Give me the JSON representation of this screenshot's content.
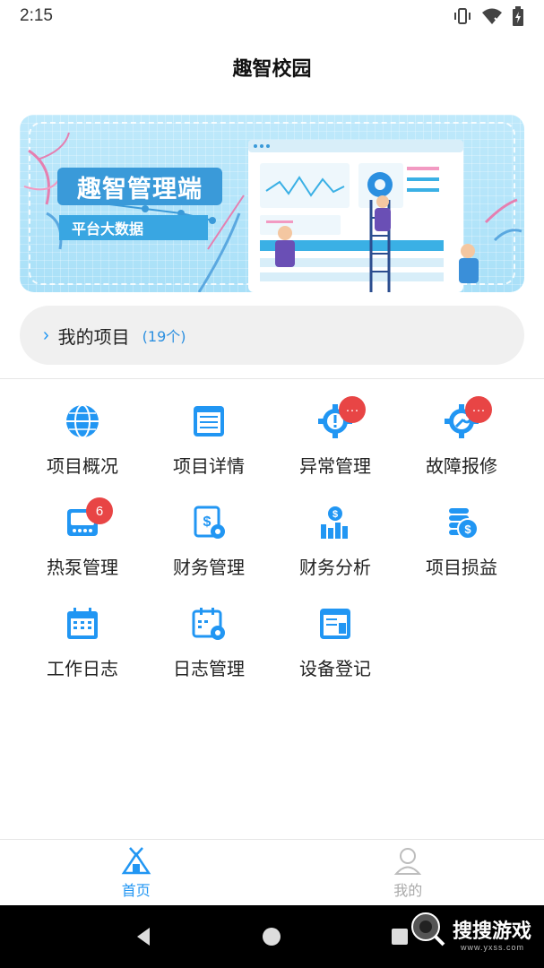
{
  "status_bar": {
    "time": "2:15",
    "icons": [
      "vibrate-icon",
      "wifi-off-icon",
      "battery-charging-icon"
    ]
  },
  "header": {
    "title": "趣智校园"
  },
  "banner": {
    "title": "趣智管理端",
    "subtitle": "平台大数据"
  },
  "project_bar": {
    "label": "我的项目",
    "count": "(19个)"
  },
  "grid": [
    {
      "label": "项目概况",
      "icon": "globe-icon",
      "badge": ""
    },
    {
      "label": "项目详情",
      "icon": "document-list-icon",
      "badge": ""
    },
    {
      "label": "异常管理",
      "icon": "gear-alert-icon",
      "badge": "···"
    },
    {
      "label": "故障报修",
      "icon": "wrench-gear-icon",
      "badge": "···"
    },
    {
      "label": "热泵管理",
      "icon": "heat-pump-icon",
      "badge": "6"
    },
    {
      "label": "财务管理",
      "icon": "finance-doc-icon",
      "badge": ""
    },
    {
      "label": "财务分析",
      "icon": "finance-chart-icon",
      "badge": ""
    },
    {
      "label": "项目损益",
      "icon": "coins-icon",
      "badge": ""
    },
    {
      "label": "工作日志",
      "icon": "calendar-icon",
      "badge": ""
    },
    {
      "label": "日志管理",
      "icon": "calendar-gear-icon",
      "badge": ""
    },
    {
      "label": "设备登记",
      "icon": "device-register-icon",
      "badge": ""
    }
  ],
  "tab_bar": {
    "home": "首页",
    "mine": "我的"
  },
  "watermark": {
    "text": "搜搜游戏",
    "sub": "www.yxss.com"
  },
  "colors": {
    "accent": "#2196f3",
    "badge": "#e84545",
    "banner": "#bfe9fb"
  }
}
